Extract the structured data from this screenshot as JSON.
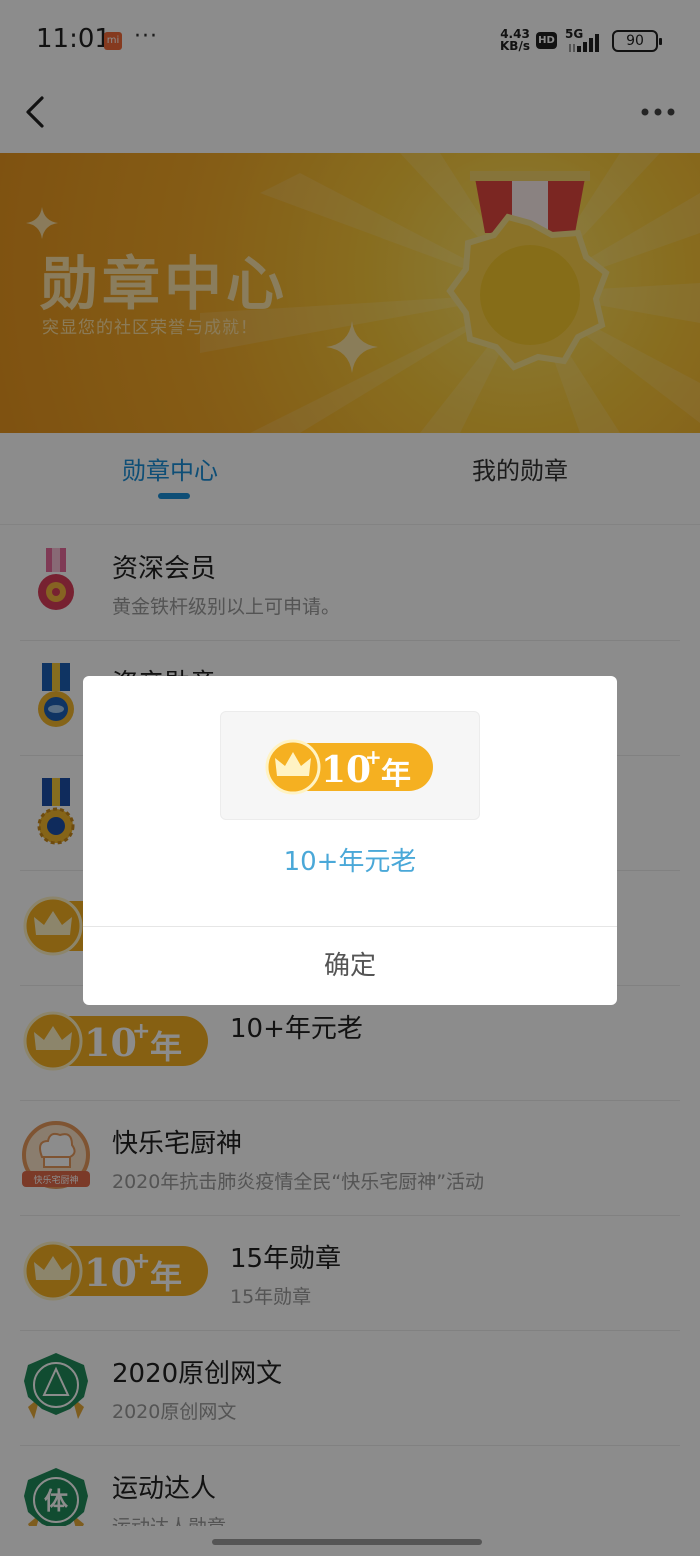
{
  "status_bar": {
    "time": "11:01",
    "mi_badge": "mi",
    "dots": "···",
    "net_speed_value": "4.43",
    "net_speed_unit": "KB/s",
    "hd": "HD",
    "signal": "5G",
    "battery": "90"
  },
  "banner": {
    "title": "勋章中心",
    "subtitle": "突显您的社区荣誉与成就！"
  },
  "tabs": [
    {
      "label": "勋章中心",
      "active": true
    },
    {
      "label": "我的勋章",
      "active": false
    }
  ],
  "badge_text": {
    "number": "10",
    "plus": "+",
    "year": "年"
  },
  "list": [
    {
      "title": "资深会员",
      "desc": "黄金铁杆级别以上可申请。",
      "icon": "medal-pink-icon"
    },
    {
      "title": "资产勋章",
      "desc": "",
      "icon": "medal-blue-icon"
    },
    {
      "title": "",
      "desc": "",
      "icon": "medal-gear-icon"
    },
    {
      "title": "",
      "desc": "",
      "icon": "crown-badge-icon"
    },
    {
      "title": "10+年元老",
      "desc": "",
      "icon": "ten-year-badge-icon"
    },
    {
      "title": "快乐宅厨神",
      "desc": "2020年抗击肺炎疫情全民“快乐宅厨神”活动",
      "icon": "chef-badge-icon"
    },
    {
      "title": "15年勋章",
      "desc": "15年勋章",
      "icon": "ten-year-badge-icon"
    },
    {
      "title": "2020原创网文",
      "desc": "2020原创网文",
      "icon": "green-emblem-icon"
    },
    {
      "title": "运动达人",
      "desc": "运动达人勋章",
      "icon": "sport-badge-icon"
    }
  ],
  "chef_badge_label": "快乐宅厨神",
  "sport_badge_label": "体",
  "dialog": {
    "badge_name": "10+年元老",
    "confirm_label": "确定"
  },
  "colors": {
    "accent": "#1a8fd8",
    "banner_gold": "#f2a928",
    "badge_gold": "#f5b021",
    "dialog_name": "#4aa8d8"
  }
}
